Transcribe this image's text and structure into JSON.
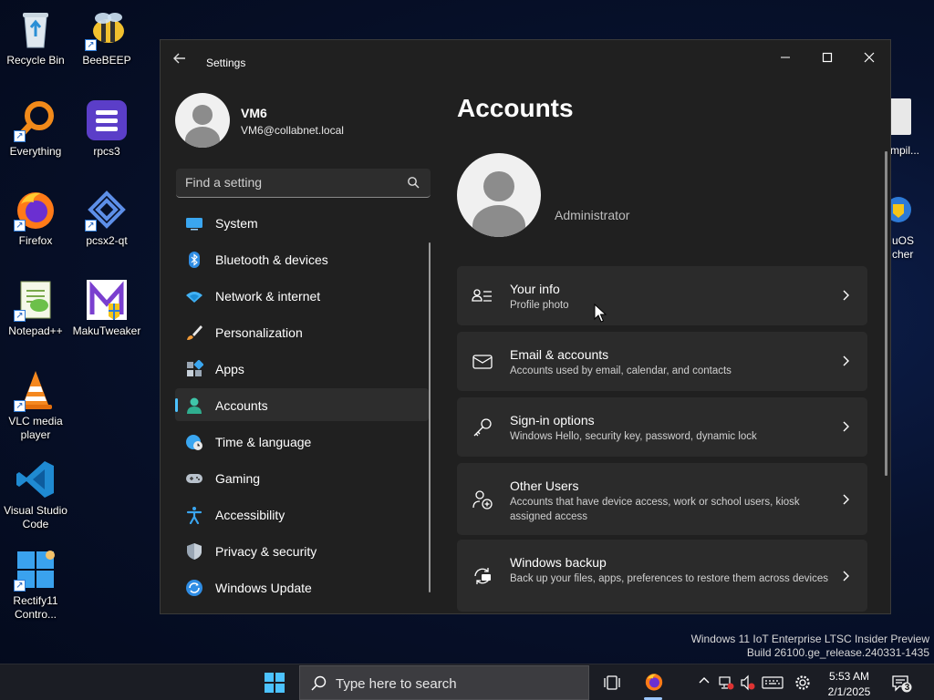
{
  "desktop": {
    "icons": [
      {
        "label": "Recycle Bin"
      },
      {
        "label": "BeeBEEP"
      },
      {
        "label": "Everything"
      },
      {
        "label": "rpcs3"
      },
      {
        "label": "Firefox"
      },
      {
        "label": "pcsx2-qt"
      },
      {
        "label": "Notepad++"
      },
      {
        "label": "MakuTweaker"
      },
      {
        "label": "VLC media player"
      },
      {
        "label": "Visual Studio Code"
      },
      {
        "label": "Rectify11 Contro..."
      }
    ],
    "partial_right": [
      "mpil...",
      "uOS",
      "cher"
    ]
  },
  "window": {
    "title": "Settings",
    "back_glyph": "←",
    "min_glyph": "—",
    "max_glyph": "☐",
    "close_glyph": "✕"
  },
  "profile": {
    "name": "VM6",
    "email": "VM6@collabnet.local"
  },
  "search": {
    "placeholder": "Find a setting"
  },
  "nav": {
    "items": [
      {
        "label": "System",
        "icon": "system-icon"
      },
      {
        "label": "Bluetooth & devices",
        "icon": "bluetooth-icon"
      },
      {
        "label": "Network & internet",
        "icon": "wifi-icon"
      },
      {
        "label": "Personalization",
        "icon": "brush-icon"
      },
      {
        "label": "Apps",
        "icon": "apps-icon"
      },
      {
        "label": "Accounts",
        "icon": "accounts-icon",
        "active": true
      },
      {
        "label": "Time & language",
        "icon": "globe-clock-icon"
      },
      {
        "label": "Gaming",
        "icon": "gamepad-icon"
      },
      {
        "label": "Accessibility",
        "icon": "accessibility-icon"
      },
      {
        "label": "Privacy & security",
        "icon": "shield-icon"
      },
      {
        "label": "Windows Update",
        "icon": "update-icon"
      }
    ]
  },
  "main": {
    "title": "Accounts",
    "role": "Administrator",
    "cards": [
      {
        "title": "Your info",
        "subtitle": "Profile photo",
        "icon": "user-info-icon"
      },
      {
        "title": "Email & accounts",
        "subtitle": "Accounts used by email, calendar, and contacts",
        "icon": "mail-icon"
      },
      {
        "title": "Sign-in options",
        "subtitle": "Windows Hello, security key, password, dynamic lock",
        "icon": "key-icon"
      },
      {
        "title": "Other Users",
        "subtitle": "Accounts that have device access, work or school users, kiosk assigned access",
        "icon": "add-user-icon"
      },
      {
        "title": "Windows backup",
        "subtitle": "Back up your files, apps, preferences to restore them across devices",
        "icon": "backup-icon"
      }
    ]
  },
  "watermark": {
    "line1": "Windows 11 IoT Enterprise LTSC Insider Preview",
    "line2": "Build 26100.ge_release.240331-1435"
  },
  "taskbar": {
    "search_text": "Type here to search",
    "time": "5:53 AM",
    "date": "2/1/2025",
    "notification_count": "3"
  },
  "colors": {
    "accent": "#4cc2ff",
    "window_bg": "#202020",
    "card_bg": "#2b2b2b"
  }
}
